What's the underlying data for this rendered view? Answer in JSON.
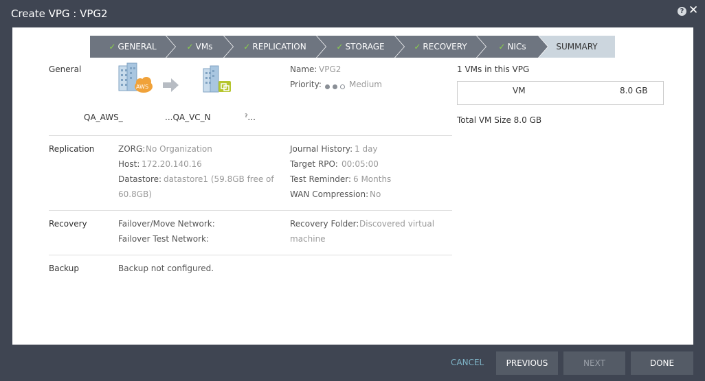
{
  "window": {
    "title": "Create VPG : VPG2"
  },
  "steps": [
    {
      "label": "GENERAL",
      "done": true
    },
    {
      "label": "VMs",
      "done": true
    },
    {
      "label": "REPLICATION",
      "done": true
    },
    {
      "label": "STORAGE",
      "done": true
    },
    {
      "label": "RECOVERY",
      "done": true
    },
    {
      "label": "NICs",
      "done": true
    },
    {
      "label": "SUMMARY",
      "done": false
    }
  ],
  "general": {
    "section_label": "General",
    "source_site": "QA_AWS_",
    "target_site": "...QA_VC_N",
    "target_extra": "ˀ...",
    "source_badge": "AWS",
    "name_key": "Name:",
    "name_val": "VPG2",
    "priority_key": "Priority:",
    "priority_val": "Medium"
  },
  "replication": {
    "section_label": "Replication",
    "zorg_key": "ZORG:",
    "zorg_val": "No Organization",
    "host_key": "Host:",
    "host_val": "172.20.140.16",
    "datastore_key": "Datastore:",
    "datastore_val_1": "datastore1 (59.8GB free of",
    "datastore_val_2": "60.8GB)",
    "journal_key": "Journal History:",
    "journal_val": "1 day",
    "rpo_key": "Target RPO:",
    "rpo_val": "00:05:00",
    "reminder_key": "Test Reminder:",
    "reminder_val": "6 Months",
    "wan_key": "WAN Compression:",
    "wan_val": "No"
  },
  "recovery": {
    "section_label": "Recovery",
    "failover_key": "Failover/Move Network:",
    "test_key": "Failover Test Network:",
    "folder_key": "Recovery Folder:",
    "folder_val_1": "Discovered virtual",
    "folder_val_2": "machine"
  },
  "backup": {
    "section_label": "Backup",
    "text": "Backup not configured."
  },
  "vms": {
    "heading": "1 VMs in this VPG",
    "vm_label": "VM",
    "vm_size": "8.0 GB",
    "total": "Total VM Size 8.0 GB"
  },
  "footer": {
    "cancel": "CANCEL",
    "previous": "PREVIOUS",
    "next": "NEXT",
    "done": "DONE"
  },
  "colors": {
    "background": "#3f4552",
    "step_done": "#6e7580",
    "step_current": "#ccd6de",
    "check": "#8bd14a",
    "cancel_link": "#7fb5c8"
  }
}
